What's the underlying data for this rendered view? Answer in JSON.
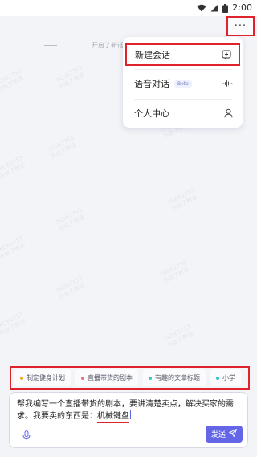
{
  "status_bar": {
    "time": "2:00",
    "icons": [
      "wifi-icon",
      "signal-icon",
      "battery-icon"
    ]
  },
  "header": {
    "more_label": "···"
  },
  "hint": {
    "text": "开启了新话"
  },
  "menu": {
    "items": [
      {
        "label": "新建会话",
        "icon": "new-chat-icon"
      },
      {
        "label": "语音对话",
        "badge": "Beta",
        "icon": "voice-wave-icon"
      },
      {
        "label": "个人中心",
        "icon": "user-icon"
      }
    ]
  },
  "suggestions": [
    {
      "label": "制定健身计划",
      "dot_color": "#f5a623"
    },
    {
      "label": "直播带货的剧本",
      "dot_color": "#f06a8a"
    },
    {
      "label": "有趣的文章标题",
      "dot_color": "#34c3c9"
    },
    {
      "label": "小学",
      "dot_color": "#34c3c9"
    }
  ],
  "composer": {
    "text_before": "帮我编写一个直播带货的剧本，要讲清楚卖点，解决买家的需求。我要卖的东西是：",
    "highlighted_text": "机械键盘",
    "send_label": "发送"
  },
  "colors": {
    "accent": "#6366e6",
    "annotation": "#e0222d"
  }
}
